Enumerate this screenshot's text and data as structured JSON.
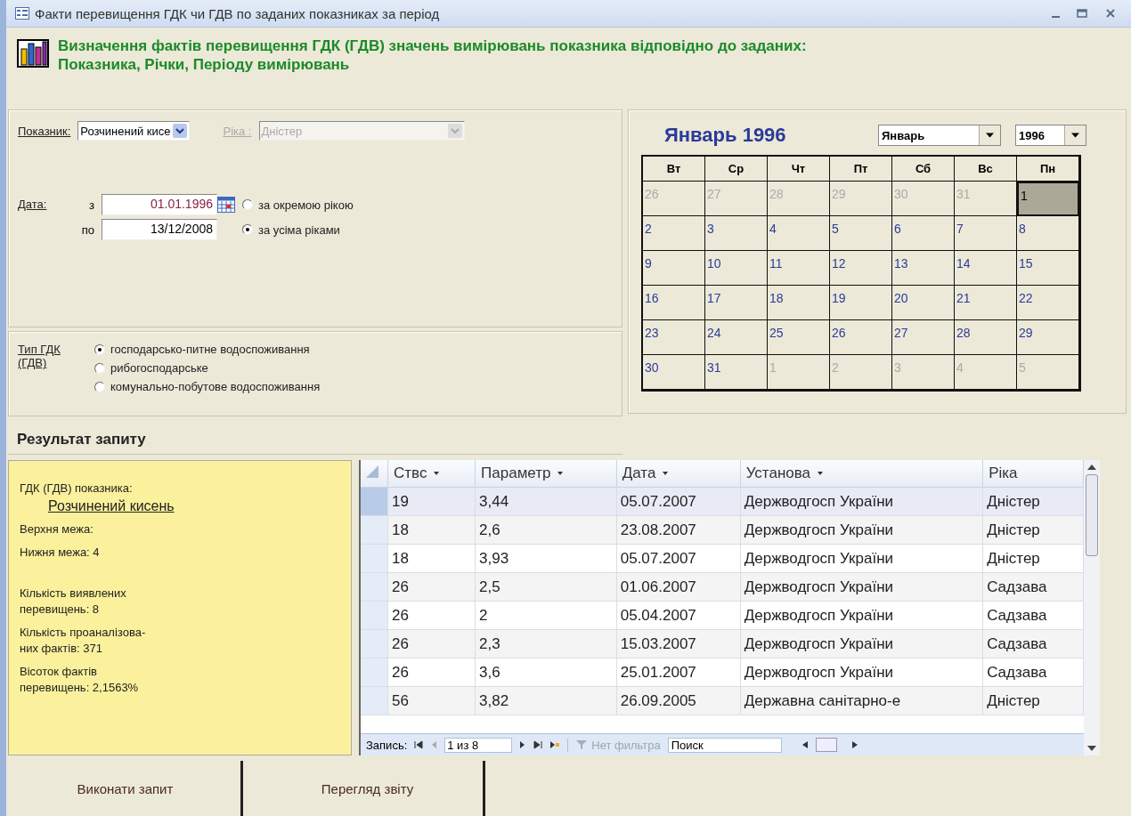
{
  "window": {
    "title": "Факти перевищення ГДК чи ГДВ по заданих показниках за період"
  },
  "header": {
    "text": "Визначення фактів перевищення ГДК (ГДВ) значень вимірювань показника відповідно до заданих: Показника, Річки, Періоду вимірювань"
  },
  "filter": {
    "indicator": {
      "label": "Показник:",
      "value": "Розчинений кисе"
    },
    "river": {
      "label": "Ріка :",
      "value": "Дністер",
      "disabled": true
    },
    "date": {
      "label": "Дата:",
      "from_label": "з",
      "from": "01.01.1996",
      "to_label": "по",
      "to": "13/12/2008"
    },
    "scope": [
      {
        "label": "за окремою рікою",
        "selected": false
      },
      {
        "label": "за усіма ріками",
        "selected": true
      }
    ]
  },
  "limit_type": {
    "label": "Тип ГДК (ГДВ)",
    "options": [
      {
        "label": "господарсько-питне водоспоживання",
        "selected": true
      },
      {
        "label": "рибогосподарське",
        "selected": false
      },
      {
        "label": "комунально-побутове водоспоживання",
        "selected": false
      }
    ]
  },
  "calendar": {
    "title": "Январь 1996",
    "month": "Январь",
    "year": "1996",
    "weekdays": [
      "Вт",
      "Ср",
      "Чт",
      "Пт",
      "Сб",
      "Вс",
      "Пн"
    ],
    "weeks": [
      [
        {
          "day": "26",
          "other_month": true,
          "selected": false
        },
        {
          "day": "27",
          "other_month": true,
          "selected": false
        },
        {
          "day": "28",
          "other_month": true,
          "selected": false
        },
        {
          "day": "29",
          "other_month": true,
          "selected": false
        },
        {
          "day": "30",
          "other_month": true,
          "selected": false
        },
        {
          "day": "31",
          "other_month": true,
          "selected": false
        },
        {
          "day": "1",
          "other_month": false,
          "selected": true
        }
      ],
      [
        {
          "day": "2",
          "other_month": false,
          "selected": false
        },
        {
          "day": "3",
          "other_month": false,
          "selected": false
        },
        {
          "day": "4",
          "other_month": false,
          "selected": false
        },
        {
          "day": "5",
          "other_month": false,
          "selected": false
        },
        {
          "day": "6",
          "other_month": false,
          "selected": false
        },
        {
          "day": "7",
          "other_month": false,
          "selected": false
        },
        {
          "day": "8",
          "other_month": false,
          "selected": false
        }
      ],
      [
        {
          "day": "9",
          "other_month": false,
          "selected": false
        },
        {
          "day": "10",
          "other_month": false,
          "selected": false
        },
        {
          "day": "11",
          "other_month": false,
          "selected": false
        },
        {
          "day": "12",
          "other_month": false,
          "selected": false
        },
        {
          "day": "13",
          "other_month": false,
          "selected": false
        },
        {
          "day": "14",
          "other_month": false,
          "selected": false
        },
        {
          "day": "15",
          "other_month": false,
          "selected": false
        }
      ],
      [
        {
          "day": "16",
          "other_month": false,
          "selected": false
        },
        {
          "day": "17",
          "other_month": false,
          "selected": false
        },
        {
          "day": "18",
          "other_month": false,
          "selected": false
        },
        {
          "day": "19",
          "other_month": false,
          "selected": false
        },
        {
          "day": "20",
          "other_month": false,
          "selected": false
        },
        {
          "day": "21",
          "other_month": false,
          "selected": false
        },
        {
          "day": "22",
          "other_month": false,
          "selected": false
        }
      ],
      [
        {
          "day": "23",
          "other_month": false,
          "selected": false
        },
        {
          "day": "24",
          "other_month": false,
          "selected": false
        },
        {
          "day": "25",
          "other_month": false,
          "selected": false
        },
        {
          "day": "26",
          "other_month": false,
          "selected": false
        },
        {
          "day": "27",
          "other_month": false,
          "selected": false
        },
        {
          "day": "28",
          "other_month": false,
          "selected": false
        },
        {
          "day": "29",
          "other_month": false,
          "selected": false
        }
      ],
      [
        {
          "day": "30",
          "other_month": false,
          "selected": false
        },
        {
          "day": "31",
          "other_month": false,
          "selected": false
        },
        {
          "day": "1",
          "other_month": true,
          "selected": false
        },
        {
          "day": "2",
          "other_month": true,
          "selected": false
        },
        {
          "day": "3",
          "other_month": true,
          "selected": false
        },
        {
          "day": "4",
          "other_month": true,
          "selected": false
        },
        {
          "day": "5",
          "other_month": true,
          "selected": false
        }
      ]
    ]
  },
  "result": {
    "heading": "Результат запиту",
    "summary": {
      "indicator_label": "ГДК (ГДВ) показника:",
      "indicator_value": "Розчинений кисень",
      "lines": [
        "Верхня межа:",
        "Нижня межа:  4",
        "Кількість виявлених\nперевищень:  8",
        "Кількість проаналізова-\nних фактів: 371",
        "Вісоток фактів\nперевищень:  2,1563%"
      ]
    },
    "table": {
      "columns": [
        {
          "label": "Ствс",
          "sortable": true
        },
        {
          "label": "Параметр",
          "sortable": true
        },
        {
          "label": "Дата",
          "sortable": true
        },
        {
          "label": "Установа",
          "sortable": true
        },
        {
          "label": "Ріка",
          "sortable": false
        }
      ],
      "rows": [
        {
          "cells": [
            "19",
            "3,44",
            "05.07.2007",
            "Держводгосп України",
            "Дністер"
          ],
          "selected": true
        },
        {
          "cells": [
            "18",
            "2,6",
            "23.08.2007",
            "Держводгосп України",
            "Дністер"
          ],
          "selected": false
        },
        {
          "cells": [
            "18",
            "3,93",
            "05.07.2007",
            "Держводгосп України",
            "Дністер"
          ],
          "selected": false
        },
        {
          "cells": [
            "26",
            "2,5",
            "01.06.2007",
            "Держводгосп України",
            "Садзава"
          ],
          "selected": false
        },
        {
          "cells": [
            "26",
            "2",
            "05.04.2007",
            "Держводгосп України",
            "Садзава"
          ],
          "selected": false
        },
        {
          "cells": [
            "26",
            "2,3",
            "15.03.2007",
            "Держводгосп України",
            "Садзава"
          ],
          "selected": false
        },
        {
          "cells": [
            "26",
            "3,6",
            "25.01.2007",
            "Держводгосп України",
            "Садзава"
          ],
          "selected": false
        },
        {
          "cells": [
            "56",
            "3,82",
            "26.09.2005",
            "Державна санітарно-е",
            "Дністер"
          ],
          "selected": false
        }
      ]
    },
    "navigator": {
      "label": "Запись:",
      "position": "1 из 8",
      "filter": "Нет фильтра",
      "search": "Поиск"
    }
  },
  "buttons": [
    "Виконати запит",
    "Перегляд звіту"
  ]
}
